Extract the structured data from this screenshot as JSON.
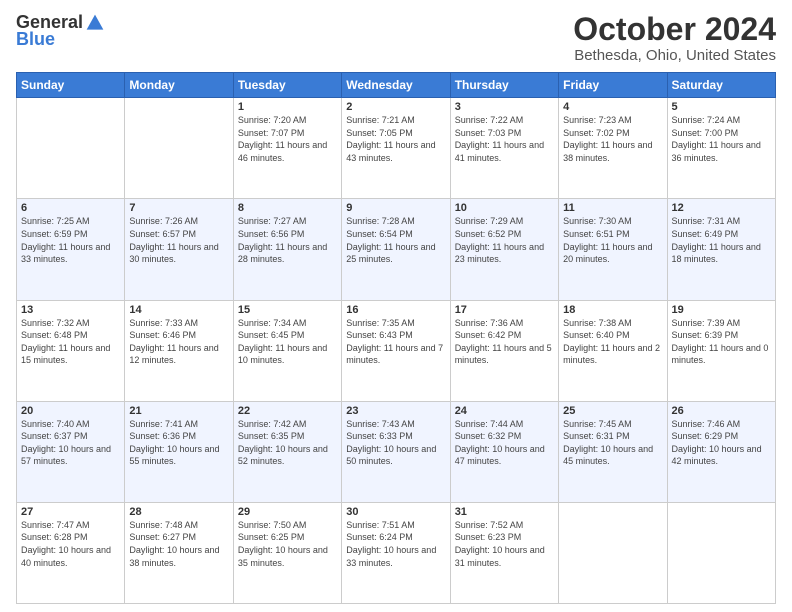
{
  "header": {
    "logo": {
      "general": "General",
      "blue": "Blue",
      "tagline": ""
    },
    "title": "October 2024",
    "location": "Bethesda, Ohio, United States"
  },
  "days_of_week": [
    "Sunday",
    "Monday",
    "Tuesday",
    "Wednesday",
    "Thursday",
    "Friday",
    "Saturday"
  ],
  "weeks": [
    [
      {
        "day": "",
        "info": ""
      },
      {
        "day": "",
        "info": ""
      },
      {
        "day": "1",
        "info": "Sunrise: 7:20 AM\nSunset: 7:07 PM\nDaylight: 11 hours and 46 minutes."
      },
      {
        "day": "2",
        "info": "Sunrise: 7:21 AM\nSunset: 7:05 PM\nDaylight: 11 hours and 43 minutes."
      },
      {
        "day": "3",
        "info": "Sunrise: 7:22 AM\nSunset: 7:03 PM\nDaylight: 11 hours and 41 minutes."
      },
      {
        "day": "4",
        "info": "Sunrise: 7:23 AM\nSunset: 7:02 PM\nDaylight: 11 hours and 38 minutes."
      },
      {
        "day": "5",
        "info": "Sunrise: 7:24 AM\nSunset: 7:00 PM\nDaylight: 11 hours and 36 minutes."
      }
    ],
    [
      {
        "day": "6",
        "info": "Sunrise: 7:25 AM\nSunset: 6:59 PM\nDaylight: 11 hours and 33 minutes."
      },
      {
        "day": "7",
        "info": "Sunrise: 7:26 AM\nSunset: 6:57 PM\nDaylight: 11 hours and 30 minutes."
      },
      {
        "day": "8",
        "info": "Sunrise: 7:27 AM\nSunset: 6:56 PM\nDaylight: 11 hours and 28 minutes."
      },
      {
        "day": "9",
        "info": "Sunrise: 7:28 AM\nSunset: 6:54 PM\nDaylight: 11 hours and 25 minutes."
      },
      {
        "day": "10",
        "info": "Sunrise: 7:29 AM\nSunset: 6:52 PM\nDaylight: 11 hours and 23 minutes."
      },
      {
        "day": "11",
        "info": "Sunrise: 7:30 AM\nSunset: 6:51 PM\nDaylight: 11 hours and 20 minutes."
      },
      {
        "day": "12",
        "info": "Sunrise: 7:31 AM\nSunset: 6:49 PM\nDaylight: 11 hours and 18 minutes."
      }
    ],
    [
      {
        "day": "13",
        "info": "Sunrise: 7:32 AM\nSunset: 6:48 PM\nDaylight: 11 hours and 15 minutes."
      },
      {
        "day": "14",
        "info": "Sunrise: 7:33 AM\nSunset: 6:46 PM\nDaylight: 11 hours and 12 minutes."
      },
      {
        "day": "15",
        "info": "Sunrise: 7:34 AM\nSunset: 6:45 PM\nDaylight: 11 hours and 10 minutes."
      },
      {
        "day": "16",
        "info": "Sunrise: 7:35 AM\nSunset: 6:43 PM\nDaylight: 11 hours and 7 minutes."
      },
      {
        "day": "17",
        "info": "Sunrise: 7:36 AM\nSunset: 6:42 PM\nDaylight: 11 hours and 5 minutes."
      },
      {
        "day": "18",
        "info": "Sunrise: 7:38 AM\nSunset: 6:40 PM\nDaylight: 11 hours and 2 minutes."
      },
      {
        "day": "19",
        "info": "Sunrise: 7:39 AM\nSunset: 6:39 PM\nDaylight: 11 hours and 0 minutes."
      }
    ],
    [
      {
        "day": "20",
        "info": "Sunrise: 7:40 AM\nSunset: 6:37 PM\nDaylight: 10 hours and 57 minutes."
      },
      {
        "day": "21",
        "info": "Sunrise: 7:41 AM\nSunset: 6:36 PM\nDaylight: 10 hours and 55 minutes."
      },
      {
        "day": "22",
        "info": "Sunrise: 7:42 AM\nSunset: 6:35 PM\nDaylight: 10 hours and 52 minutes."
      },
      {
        "day": "23",
        "info": "Sunrise: 7:43 AM\nSunset: 6:33 PM\nDaylight: 10 hours and 50 minutes."
      },
      {
        "day": "24",
        "info": "Sunrise: 7:44 AM\nSunset: 6:32 PM\nDaylight: 10 hours and 47 minutes."
      },
      {
        "day": "25",
        "info": "Sunrise: 7:45 AM\nSunset: 6:31 PM\nDaylight: 10 hours and 45 minutes."
      },
      {
        "day": "26",
        "info": "Sunrise: 7:46 AM\nSunset: 6:29 PM\nDaylight: 10 hours and 42 minutes."
      }
    ],
    [
      {
        "day": "27",
        "info": "Sunrise: 7:47 AM\nSunset: 6:28 PM\nDaylight: 10 hours and 40 minutes."
      },
      {
        "day": "28",
        "info": "Sunrise: 7:48 AM\nSunset: 6:27 PM\nDaylight: 10 hours and 38 minutes."
      },
      {
        "day": "29",
        "info": "Sunrise: 7:50 AM\nSunset: 6:25 PM\nDaylight: 10 hours and 35 minutes."
      },
      {
        "day": "30",
        "info": "Sunrise: 7:51 AM\nSunset: 6:24 PM\nDaylight: 10 hours and 33 minutes."
      },
      {
        "day": "31",
        "info": "Sunrise: 7:52 AM\nSunset: 6:23 PM\nDaylight: 10 hours and 31 minutes."
      },
      {
        "day": "",
        "info": ""
      },
      {
        "day": "",
        "info": ""
      }
    ]
  ]
}
